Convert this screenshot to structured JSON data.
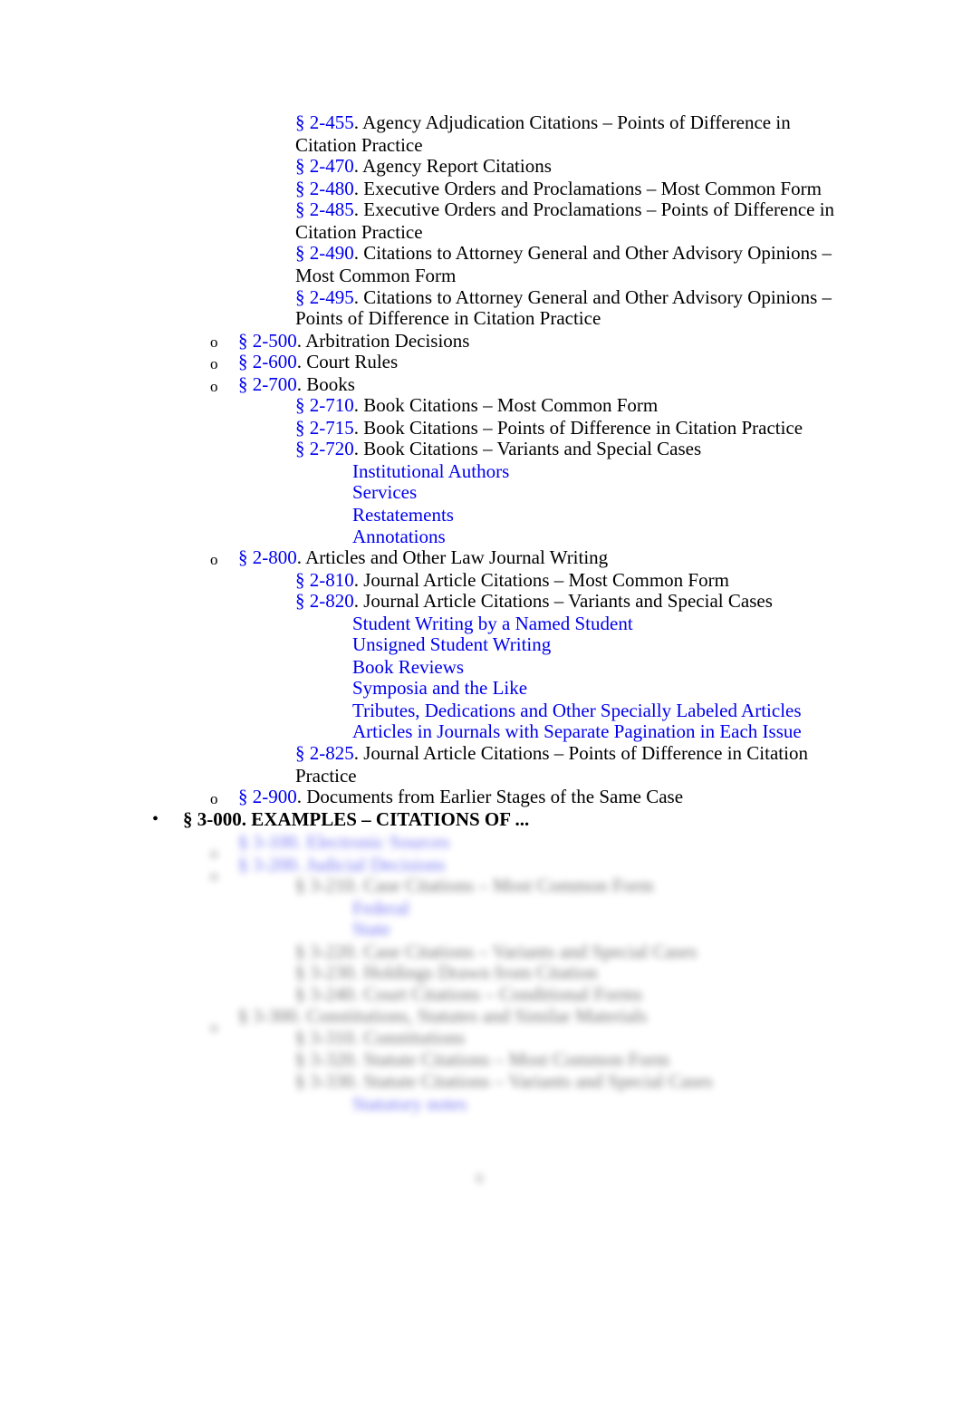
{
  "entries_top": [
    {
      "sec": "§ 2-455",
      "text": ". Agency Adjudication Citations – Points of Difference in",
      "cont": "Citation Practice"
    },
    {
      "sec": "§ 2-470",
      "text": ". Agency Report Citations"
    },
    {
      "sec": "§ 2-480",
      "text": ". Executive Orders and Proclamations – Most Common Form"
    },
    {
      "sec": "§ 2-485",
      "text": ". Executive Orders and Proclamations – Points of Difference in",
      "cont": "Citation Practice"
    },
    {
      "sec": "§ 2-490",
      "text": ". Citations to Attorney General and Other Advisory Opinions –",
      "cont": "Most Common Form"
    },
    {
      "sec": "§ 2-495",
      "text": ". Citations to Attorney General and Other Advisory Opinions –",
      "cont": "Points of Difference in Citation Practice"
    }
  ],
  "l2": {
    "s500": {
      "sec": "§ 2-500",
      "text": ". Arbitration Decisions"
    },
    "s600": {
      "sec": "§ 2-600",
      "text": ". Court Rules"
    },
    "s700": {
      "sec": "§ 2-700",
      "text": ". Books"
    },
    "s800": {
      "sec": "§ 2-800",
      "text": ". Articles and Other Law Journal Writing"
    },
    "s900": {
      "sec": "§ 2-900",
      "text": ". Documents from Earlier Stages of the Same Case"
    }
  },
  "books": [
    {
      "sec": "§ 2-710",
      "text": ". Book Citations – Most Common Form"
    },
    {
      "sec": "§ 2-715",
      "text": ". Book Citations – Points of Difference in Citation Practice"
    },
    {
      "sec": "§ 2-720",
      "text": ". Book Citations – Variants and Special Cases"
    }
  ],
  "books_sub": [
    "Institutional Authors",
    "Services",
    "Restatements",
    "Annotations"
  ],
  "articles": [
    {
      "sec": "§ 2-810",
      "text": ". Journal Article Citations – Most Common Form"
    },
    {
      "sec": "§ 2-820",
      "text": ". Journal Article Citations – Variants and Special Cases"
    }
  ],
  "articles_sub": [
    "Student Writing by a Named Student",
    "Unsigned Student Writing",
    "Book Reviews",
    "Symposia and the Like",
    "Tributes, Dedications and Other Specially Labeled Articles",
    "Articles in Journals with Separate Pagination in Each Issue"
  ],
  "s825": {
    "sec": "§ 2-825",
    "text": ". Journal Article Citations – Points of Difference in Citation",
    "cont": "Practice"
  },
  "s3000": "§ 3-000. EXAMPLES – CITATIONS OF ...",
  "blurred": {
    "a": "§ 3-100. Electronic Sources",
    "b": "§ 3-200. Judicial Decisions",
    "c": "§ 3-210. Case Citations – Most Common Form",
    "d": "Federal",
    "e": "State",
    "f": "§ 3-220. Case Citations – Variants and Special Cases",
    "g": "§ 3-230. Holdings Drawn from Citation",
    "h": "§ 3-240. Court Citations – Conditional Forms",
    "i": "§ 3-300. Constitutions, Statutes and Similar Materials",
    "j": "§ 3-310. Constitutions",
    "k": "§ 3-320. Statute Citations – Most Common Form",
    "l": "§ 3-330. Statute Citations – Variants and Special Cases",
    "m": "Statutory notes"
  },
  "page_number": "ii"
}
